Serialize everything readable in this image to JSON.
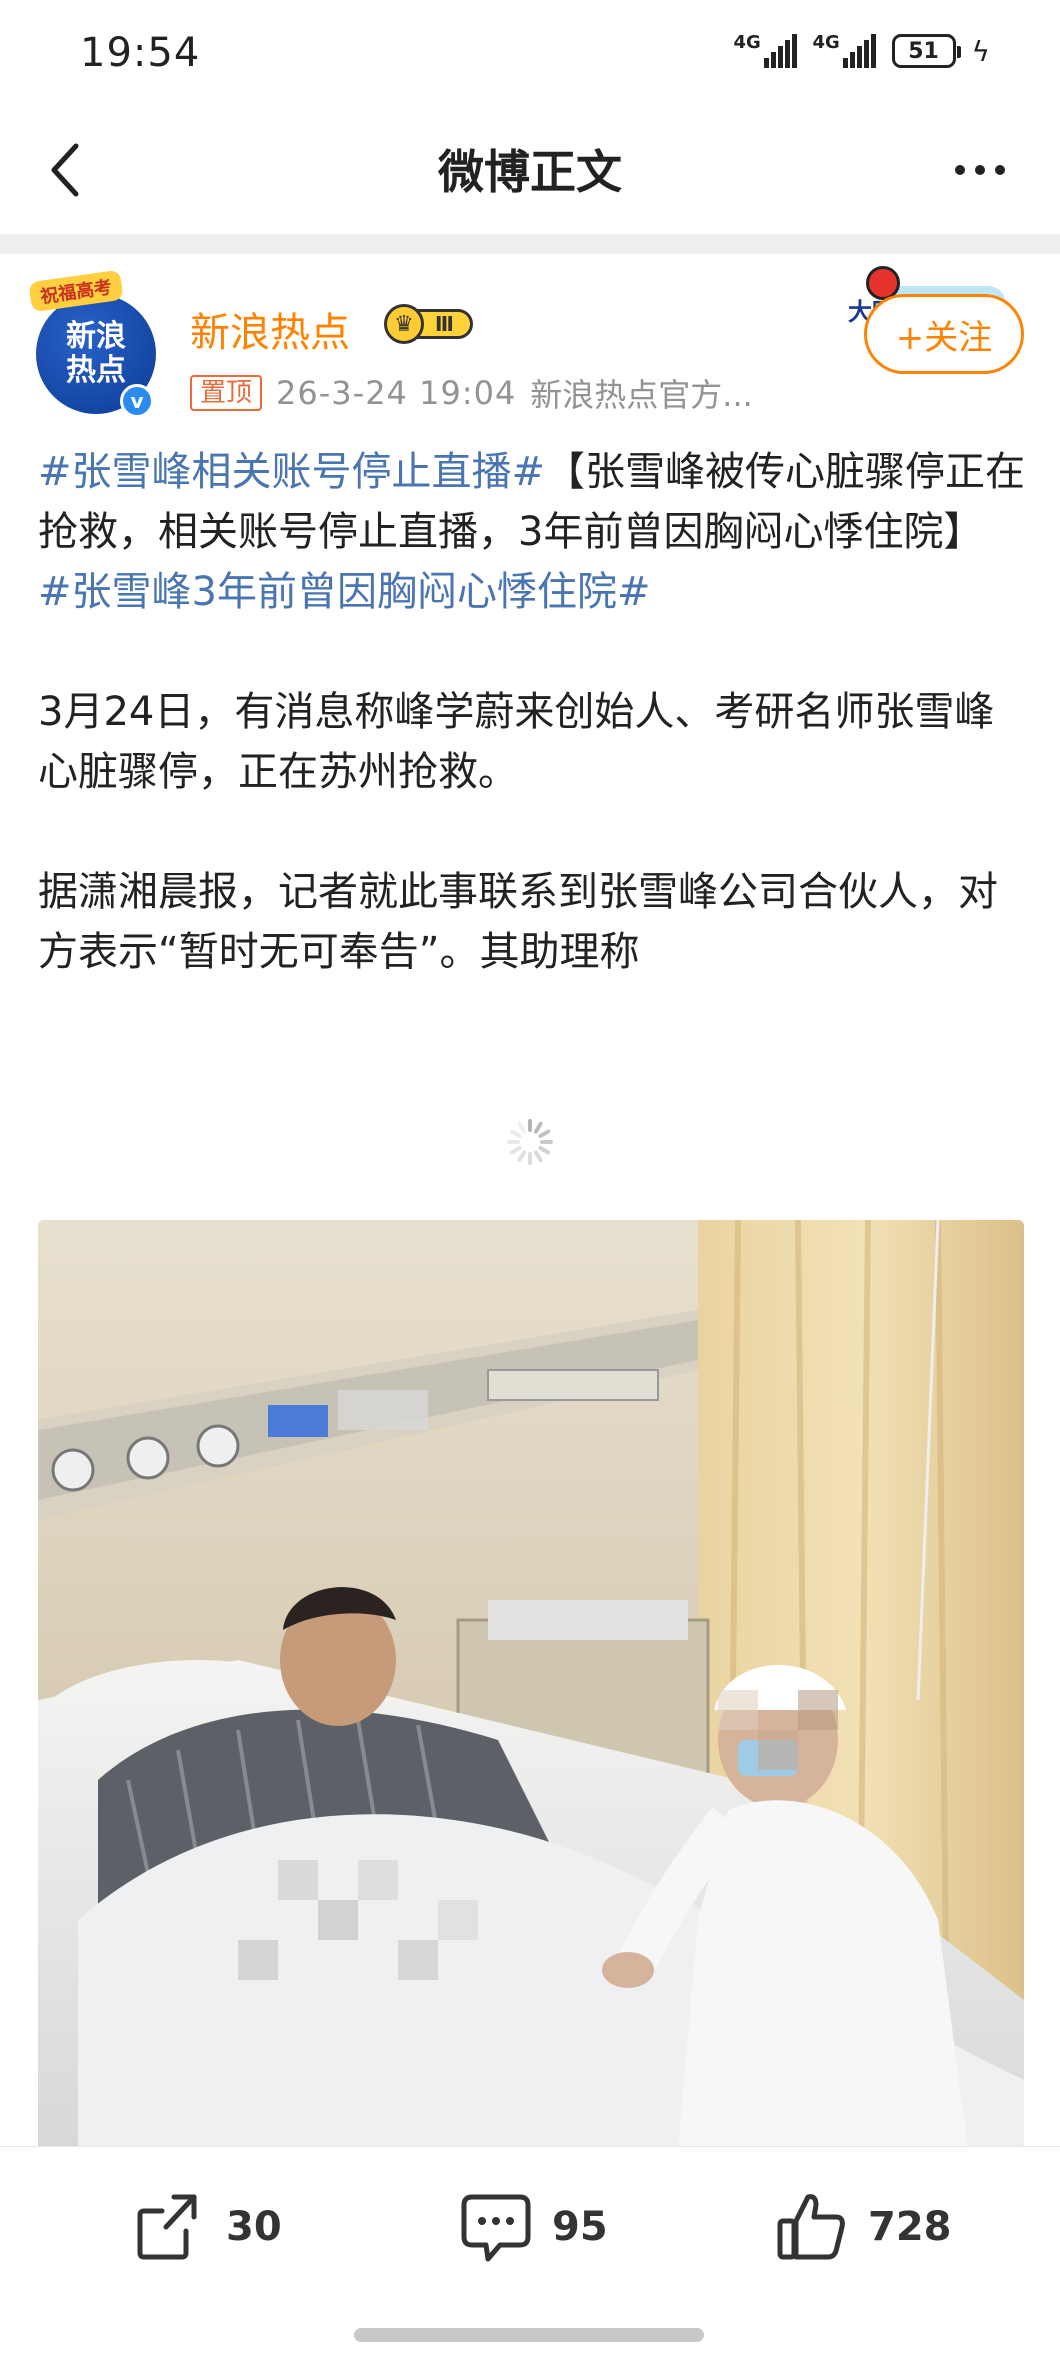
{
  "status_bar": {
    "time": "19:54",
    "signal_1": "4G",
    "signal_2": "4G",
    "battery": "51"
  },
  "nav": {
    "title": "微博正文"
  },
  "post": {
    "user_name": "新浪热点",
    "vip_level": "Ⅲ",
    "avatar_text_1": "新浪",
    "avatar_text_2": "热点",
    "avatar_ribbon": "祝福高考",
    "pin_tag": "置顶",
    "time": "26-3-24 19:04",
    "source": "新浪热点官方...",
    "follow_label": "+关注",
    "follow_deco_text": "大眼",
    "paragraph_1": {
      "topic_1": "#张雪峰相关账号停止直播#",
      "text_1": "【张雪峰被传心脏骤停正在抢救，相关账号停止直播，3年前曾因胸闷心悸住院】",
      "topic_2": "#张雪峰3年前曾因胸闷心悸住院#"
    },
    "paragraph_2": "3月24日，有消息称峰学蔚来创始人、考研名师张雪峰心脏骤停，正在苏州抢救。",
    "paragraph_3": "据潇湘晨报，记者就此事联系到张雪峰公司合伙人，对方表示“暂时无可奉告”。其助理称"
  },
  "actions": {
    "repost_count": "30",
    "comment_count": "95",
    "like_count": "728"
  },
  "colors": {
    "accent_orange": "#ff8200",
    "topic_blue": "#4a75b3",
    "meta_gray": "#939393",
    "pin_tag": "#e86c3a"
  },
  "icons": [
    "back-arrow-icon",
    "more-icon",
    "verified-icon",
    "vip-crown-icon",
    "loading-spinner-icon",
    "repost-icon",
    "comment-icon",
    "like-icon"
  ]
}
